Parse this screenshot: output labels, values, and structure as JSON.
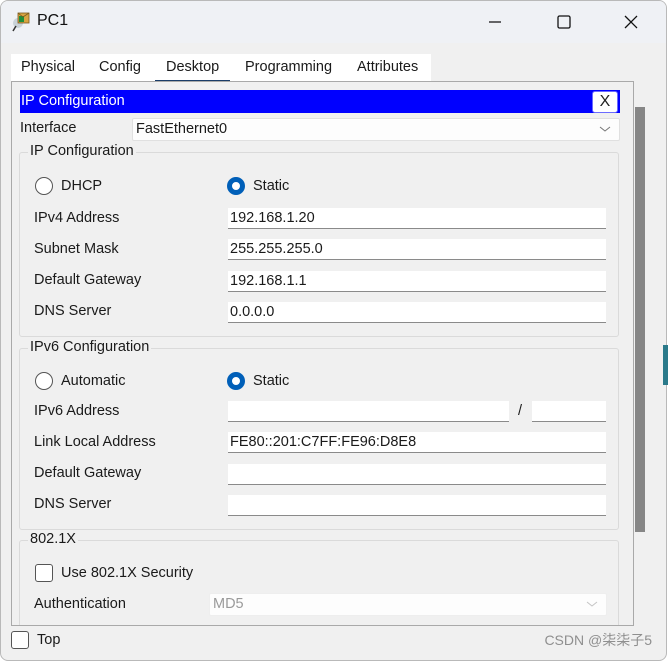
{
  "window": {
    "title": "PC1",
    "controls": {
      "minimize_icon": "minimize-icon",
      "maximize_icon": "maximize-icon",
      "close_icon": "close-icon"
    }
  },
  "tabs": [
    {
      "label": "Physical",
      "active": false
    },
    {
      "label": "Config",
      "active": false
    },
    {
      "label": "Desktop",
      "active": true
    },
    {
      "label": "Programming",
      "active": false
    },
    {
      "label": "Attributes",
      "active": false
    }
  ],
  "panel": {
    "title": "IP Configuration",
    "close_label": "X",
    "interface_label": "Interface",
    "interface_value": "FastEthernet0"
  },
  "ipv4": {
    "legend": "IP Configuration",
    "dhcp_label": "DHCP",
    "static_label": "Static",
    "mode": "Static",
    "fields": [
      {
        "label": "IPv4 Address",
        "value": "192.168.1.20"
      },
      {
        "label": "Subnet Mask",
        "value": "255.255.255.0"
      },
      {
        "label": "Default Gateway",
        "value": "192.168.1.1"
      },
      {
        "label": "DNS Server",
        "value": "0.0.0.0"
      }
    ]
  },
  "ipv6": {
    "legend": "IPv6 Configuration",
    "automatic_label": "Automatic",
    "static_label": "Static",
    "mode": "Static",
    "address_label": "IPv6 Address",
    "address_value": "",
    "prefix_separator": "/",
    "prefix_value": "",
    "fields": [
      {
        "label": "Link Local Address",
        "value": "FE80::201:C7FF:FE96:D8E8"
      },
      {
        "label": "Default Gateway",
        "value": ""
      },
      {
        "label": "DNS Server",
        "value": ""
      }
    ]
  },
  "dot1x": {
    "legend": "802.1X",
    "use_security_label": "Use 802.1X Security",
    "use_security_checked": false,
    "authentication_label": "Authentication",
    "authentication_value": "MD5"
  },
  "footer": {
    "top_label": "Top",
    "top_checked": false
  },
  "watermark": "CSDN @柒柒子5",
  "colors": {
    "panel_title_bg": "#0000ff",
    "radio_selected": "#005fb8",
    "tab_underline": "#1a3c68"
  }
}
